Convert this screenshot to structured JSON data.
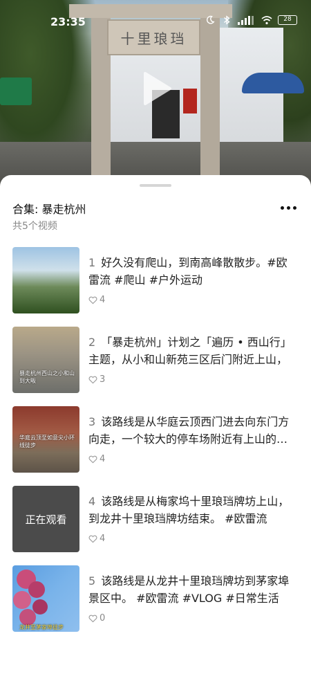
{
  "status_bar": {
    "time": "23:35",
    "battery": "28",
    "icons": [
      "moon-icon",
      "bluetooth-icon",
      "signal-icon",
      "wifi-icon",
      "battery-icon"
    ]
  },
  "video": {
    "plaque_text": "十里琅珰"
  },
  "collection": {
    "title": "合集: 暴走杭州",
    "subtitle": "共5个视频"
  },
  "items": [
    {
      "index": "1",
      "text": "好久没有爬山，到南高峰散散步。#欧雷流 #爬山 #户外运动",
      "likes": "4",
      "thumb_caption": ""
    },
    {
      "index": "2",
      "text": "「暴走杭州」计划之「遍历 • 西山行」主题，从小和山新苑三区后门附近上山，",
      "likes": "3",
      "thumb_caption": "暴走杭州西山之小和山到大畈"
    },
    {
      "index": "3",
      "text": "该路线是从华庭云顶西门进去向东门方向走，一个较大的停车场附近有上山的小路",
      "likes": "4",
      "thumb_caption": "华庭云顶至如意尖小环线徒步"
    },
    {
      "index": "4",
      "text": "该路线是从梅家坞十里琅珰牌坊上山，到龙井十里琅珰牌坊结束。 #欧雷流",
      "likes": "4",
      "thumb_caption": "正在观看"
    },
    {
      "index": "5",
      "text": "该路线是从龙井十里琅珰牌坊到茅家埠景区中。 #欧雷流 #VLOG #日常生活",
      "likes": "0",
      "thumb_caption": "龙井至茅家埠徒步"
    }
  ]
}
